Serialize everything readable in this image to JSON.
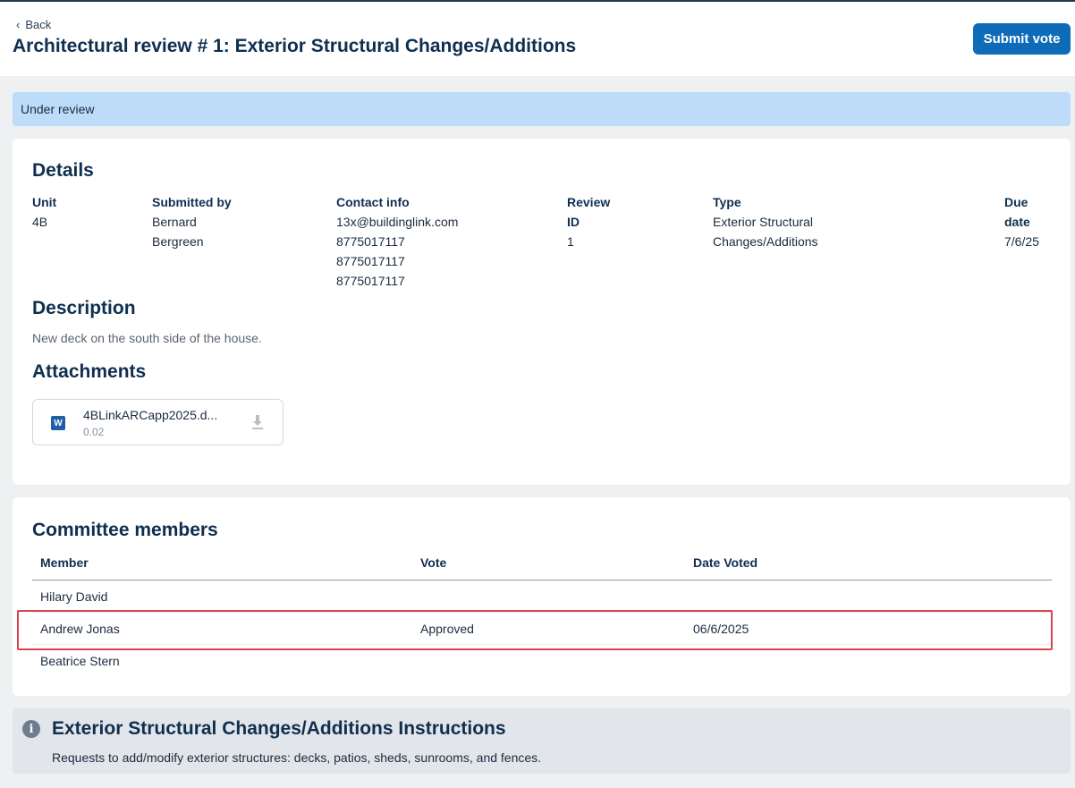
{
  "header": {
    "back_label": "Back",
    "title": "Architectural review # 1: Exterior Structural Changes/Additions",
    "submit_label": "Submit vote"
  },
  "status": {
    "text": "Under review",
    "color": "#bcdcfa"
  },
  "details": {
    "title": "Details",
    "unit": {
      "label": "Unit",
      "value": "4B"
    },
    "submitted_by": {
      "label": "Submitted by",
      "lines": [
        "Bernard",
        "Bergreen"
      ]
    },
    "contact": {
      "label": "Contact info",
      "lines": [
        "13x@buildinglink.com",
        "8775017117",
        "8775017117",
        "8775017117"
      ]
    },
    "review_id": {
      "label_lines": [
        "Review",
        "ID"
      ],
      "value": "1"
    },
    "type": {
      "label": "Type",
      "lines": [
        "Exterior Structural",
        "Changes/Additions"
      ]
    },
    "due": {
      "label_lines": [
        "Due",
        "date"
      ],
      "value": "7/6/25"
    }
  },
  "description": {
    "title": "Description",
    "text": "New deck on the south side of the house."
  },
  "attachments": {
    "title": "Attachments",
    "items": [
      {
        "icon": "word-doc-icon",
        "icon_letter": "W",
        "name": "4BLinkARCapp2025.d...",
        "size": "0.02"
      }
    ]
  },
  "committee": {
    "title": "Committee members",
    "columns": [
      "Member",
      "Vote",
      "Date Voted"
    ],
    "rows": [
      {
        "member": "Hilary David",
        "vote": "",
        "date": ""
      },
      {
        "member": "Andrew Jonas",
        "vote": "Approved",
        "date": "06/6/2025"
      },
      {
        "member": "Beatrice Stern",
        "vote": "",
        "date": ""
      }
    ],
    "highlight_color": "#d9424f"
  },
  "instructions": {
    "icon_glyph": "i",
    "title": "Exterior Structural Changes/Additions Instructions",
    "text": "Requests to add/modify exterior structures: decks, patios, sheds, sunrooms, and fences."
  },
  "colors": {
    "primary": "#0e6bb8",
    "heading": "#0f2f4f"
  }
}
